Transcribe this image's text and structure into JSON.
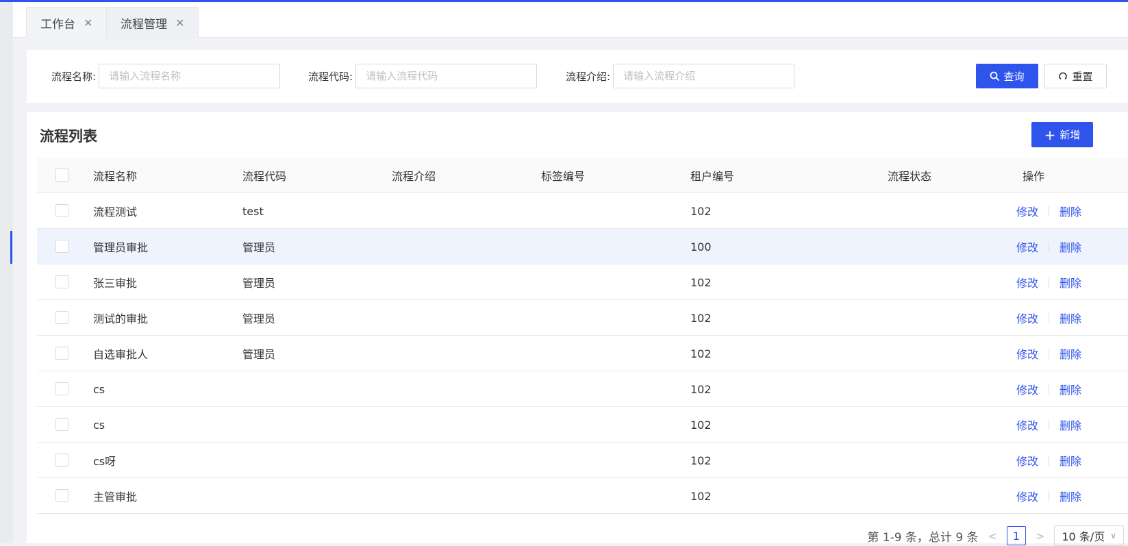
{
  "tabs": [
    {
      "label": "工作台",
      "active": false
    },
    {
      "label": "流程管理",
      "active": true
    }
  ],
  "search": {
    "fields": [
      {
        "label": "流程名称:",
        "placeholder": "请输入流程名称",
        "value": ""
      },
      {
        "label": "流程代码:",
        "placeholder": "请输入流程代码",
        "value": ""
      },
      {
        "label": "流程介绍:",
        "placeholder": "请输入流程介绍",
        "value": ""
      }
    ],
    "query_label": "查询",
    "reset_label": "重置"
  },
  "list": {
    "title": "流程列表",
    "add_label": "新增",
    "columns": [
      "流程名称",
      "流程代码",
      "流程介绍",
      "标签编号",
      "租户编号",
      "流程状态",
      "操作"
    ],
    "rows": [
      {
        "name": "流程测试",
        "code": "test",
        "intro": "",
        "tag": "",
        "tenant": "102",
        "status": ""
      },
      {
        "name": "管理员审批",
        "code": "管理员",
        "intro": "",
        "tag": "",
        "tenant": "100",
        "status": ""
      },
      {
        "name": "张三审批",
        "code": "管理员",
        "intro": "",
        "tag": "",
        "tenant": "102",
        "status": ""
      },
      {
        "name": "测试的审批",
        "code": "管理员",
        "intro": "",
        "tag": "",
        "tenant": "102",
        "status": ""
      },
      {
        "name": "自选审批人",
        "code": "管理员",
        "intro": "",
        "tag": "",
        "tenant": "102",
        "status": ""
      },
      {
        "name": "cs",
        "code": "",
        "intro": "",
        "tag": "",
        "tenant": "102",
        "status": ""
      },
      {
        "name": "cs",
        "code": "",
        "intro": "",
        "tag": "",
        "tenant": "102",
        "status": ""
      },
      {
        "name": "cs呀",
        "code": "",
        "intro": "",
        "tag": "",
        "tenant": "102",
        "status": ""
      },
      {
        "name": "主管审批",
        "code": "",
        "intro": "",
        "tag": "",
        "tenant": "102",
        "status": ""
      }
    ],
    "edit_label": "修改",
    "delete_label": "删除"
  },
  "pagination": {
    "summary": "第 1-9 条，总计 9 条",
    "current_page": "1",
    "page_size": "10 条/页"
  },
  "colors": {
    "primary": "#2f54eb",
    "highlight_row": "#eef3fe"
  }
}
